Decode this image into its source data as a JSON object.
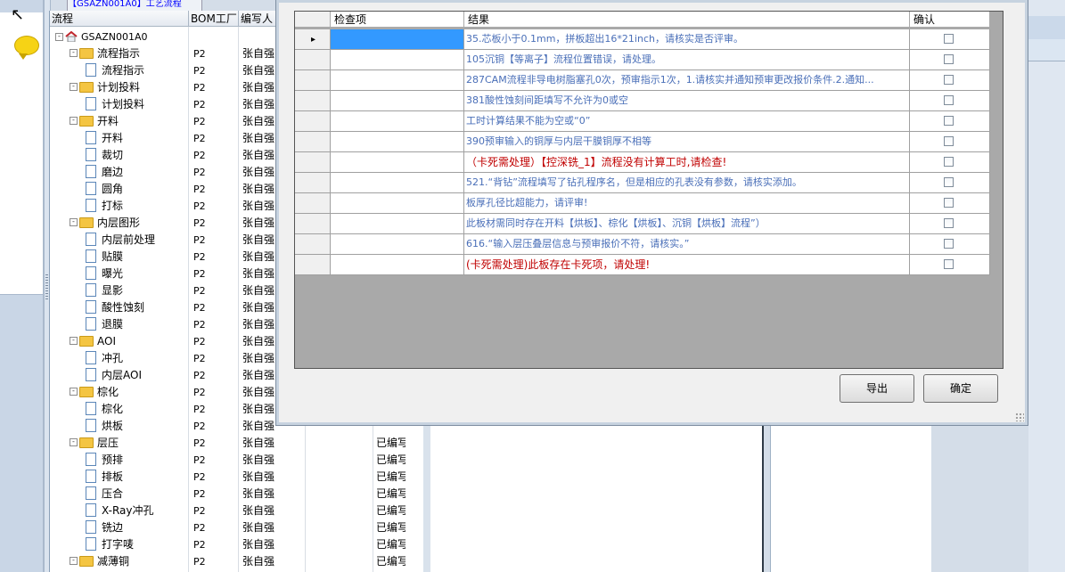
{
  "top_fragment": "【GSAZN001A0】工艺流程",
  "tree": {
    "headers": [
      "流程",
      "BOM工厂",
      "编写人"
    ],
    "root": "GSAZN001A0",
    "rows": [
      {
        "level": 1,
        "type": "folder",
        "label": "流程指示"
      },
      {
        "level": 2,
        "type": "doc",
        "label": "流程指示"
      },
      {
        "level": 1,
        "type": "folder",
        "label": "计划投料"
      },
      {
        "level": 2,
        "type": "doc",
        "label": "计划投料"
      },
      {
        "level": 1,
        "type": "folder",
        "label": "开料"
      },
      {
        "level": 2,
        "type": "doc",
        "label": "开料"
      },
      {
        "level": 2,
        "type": "doc",
        "label": "裁切"
      },
      {
        "level": 2,
        "type": "doc",
        "label": "磨边"
      },
      {
        "level": 2,
        "type": "doc",
        "label": "圆角"
      },
      {
        "level": 2,
        "type": "doc",
        "label": "打标"
      },
      {
        "level": 1,
        "type": "folder",
        "label": "内层图形"
      },
      {
        "level": 2,
        "type": "doc",
        "label": "内层前处理"
      },
      {
        "level": 2,
        "type": "doc",
        "label": "贴膜"
      },
      {
        "level": 2,
        "type": "doc",
        "label": "曝光"
      },
      {
        "level": 2,
        "type": "doc",
        "label": "显影"
      },
      {
        "level": 2,
        "type": "doc",
        "label": "酸性蚀刻"
      },
      {
        "level": 2,
        "type": "doc",
        "label": "退膜"
      },
      {
        "level": 1,
        "type": "folder",
        "label": "AOI"
      },
      {
        "level": 2,
        "type": "doc",
        "label": "冲孔"
      },
      {
        "level": 2,
        "type": "doc",
        "label": "内层AOI"
      },
      {
        "level": 1,
        "type": "folder",
        "label": "棕化"
      },
      {
        "level": 2,
        "type": "doc",
        "label": "棕化"
      },
      {
        "level": 2,
        "type": "doc",
        "label": "烘板"
      },
      {
        "level": 1,
        "type": "folder",
        "label": "层压"
      },
      {
        "level": 2,
        "type": "doc",
        "label": "预排"
      },
      {
        "level": 2,
        "type": "doc",
        "label": "排板"
      },
      {
        "level": 2,
        "type": "doc",
        "label": "压合"
      },
      {
        "level": 2,
        "type": "doc",
        "label": "X-Ray冲孔"
      },
      {
        "level": 2,
        "type": "doc",
        "label": "铣边"
      },
      {
        "level": 2,
        "type": "doc",
        "label": "打字唛"
      },
      {
        "level": 1,
        "type": "folder",
        "label": "减薄铜"
      }
    ],
    "bom": "P2",
    "author": "张自强",
    "status": "已编写"
  },
  "dialog": {
    "headers": [
      "检查项",
      "结果",
      "确认"
    ],
    "rows": [
      {
        "result": "35.芯板小于0.1mm，拼板超出16*21inch，请核实是否评审。",
        "red": false
      },
      {
        "result": "105沉铜【等离子】流程位置错误，请处理。",
        "red": false
      },
      {
        "result": "287CAM流程非导电树脂塞孔0次，预审指示1次，1.请核实并通知预审更改报价条件.2.通知...",
        "red": false
      },
      {
        "result": "381酸性蚀刻间距填写不允许为0或空",
        "red": false
      },
      {
        "result": "工时计算结果不能为空或“0”",
        "red": false
      },
      {
        "result": "390预审输入的铜厚与内层干膜铜厚不相等",
        "red": false
      },
      {
        "result": "（卡死需处理）【控深铣_1】流程没有计算工时,请检查!",
        "red": true
      },
      {
        "result": "521.“背钻”流程填写了钻孔程序名，但是相应的孔表没有参数，请核实添加。",
        "red": false
      },
      {
        "result": "板厚孔径比超能力，请评审!",
        "red": false
      },
      {
        "result": "此板材需同时存在开料【烘板】、棕化【烘板】、沉铜【烘板】流程”）",
        "red": false
      },
      {
        "result": "616.“输入层压叠层信息与预审报价不符，请核实。”",
        "red": false
      },
      {
        "result": "(卡死需处理)此板存在卡死项，请处理!",
        "red": true
      }
    ],
    "colors": {
      "blue_text": "#4a6fb8",
      "red_text": "#c00000"
    },
    "export_label": "导出",
    "ok_label": "确定"
  }
}
